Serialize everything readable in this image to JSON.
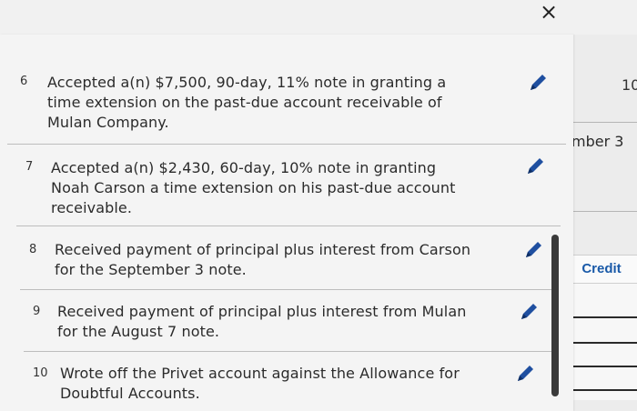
{
  "header": {
    "close_glyph": "×"
  },
  "entries": [
    {
      "number": "6",
      "lines": [
        "Accepted a(n) $7,500, 90-day, 11% note in granting a",
        "time extension on the past-due account receivable of",
        "Mulan Company."
      ],
      "edit_icon": "pencil-icon"
    },
    {
      "number": "7",
      "lines": [
        "Accepted a(n) $2,430, 60-day, 10% note in granting",
        "Noah Carson a time extension on his past-due account",
        "receivable."
      ],
      "edit_icon": "pencil-icon"
    },
    {
      "number": "8",
      "lines": [
        "Received payment of principal plus interest from Carson",
        "for the September 3 note."
      ],
      "edit_icon": "pencil-icon"
    },
    {
      "number": "9",
      "lines": [
        "Received payment of principal plus interest from Mulan",
        "for the August 7 note."
      ],
      "edit_icon": "pencil-icon"
    },
    {
      "number": "10",
      "lines": [
        "Wrote off the Privet account against the Allowance for",
        "Doubtful Accounts."
      ],
      "edit_icon": "pencil-icon"
    }
  ],
  "right_panel": {
    "bracket": ")",
    "cut_number": "10",
    "date_fragment": "mber 3",
    "credit_label": "Credit"
  },
  "colors": {
    "credit_text": "#1a5aa8",
    "edit_icon": "#1f4fa0"
  }
}
